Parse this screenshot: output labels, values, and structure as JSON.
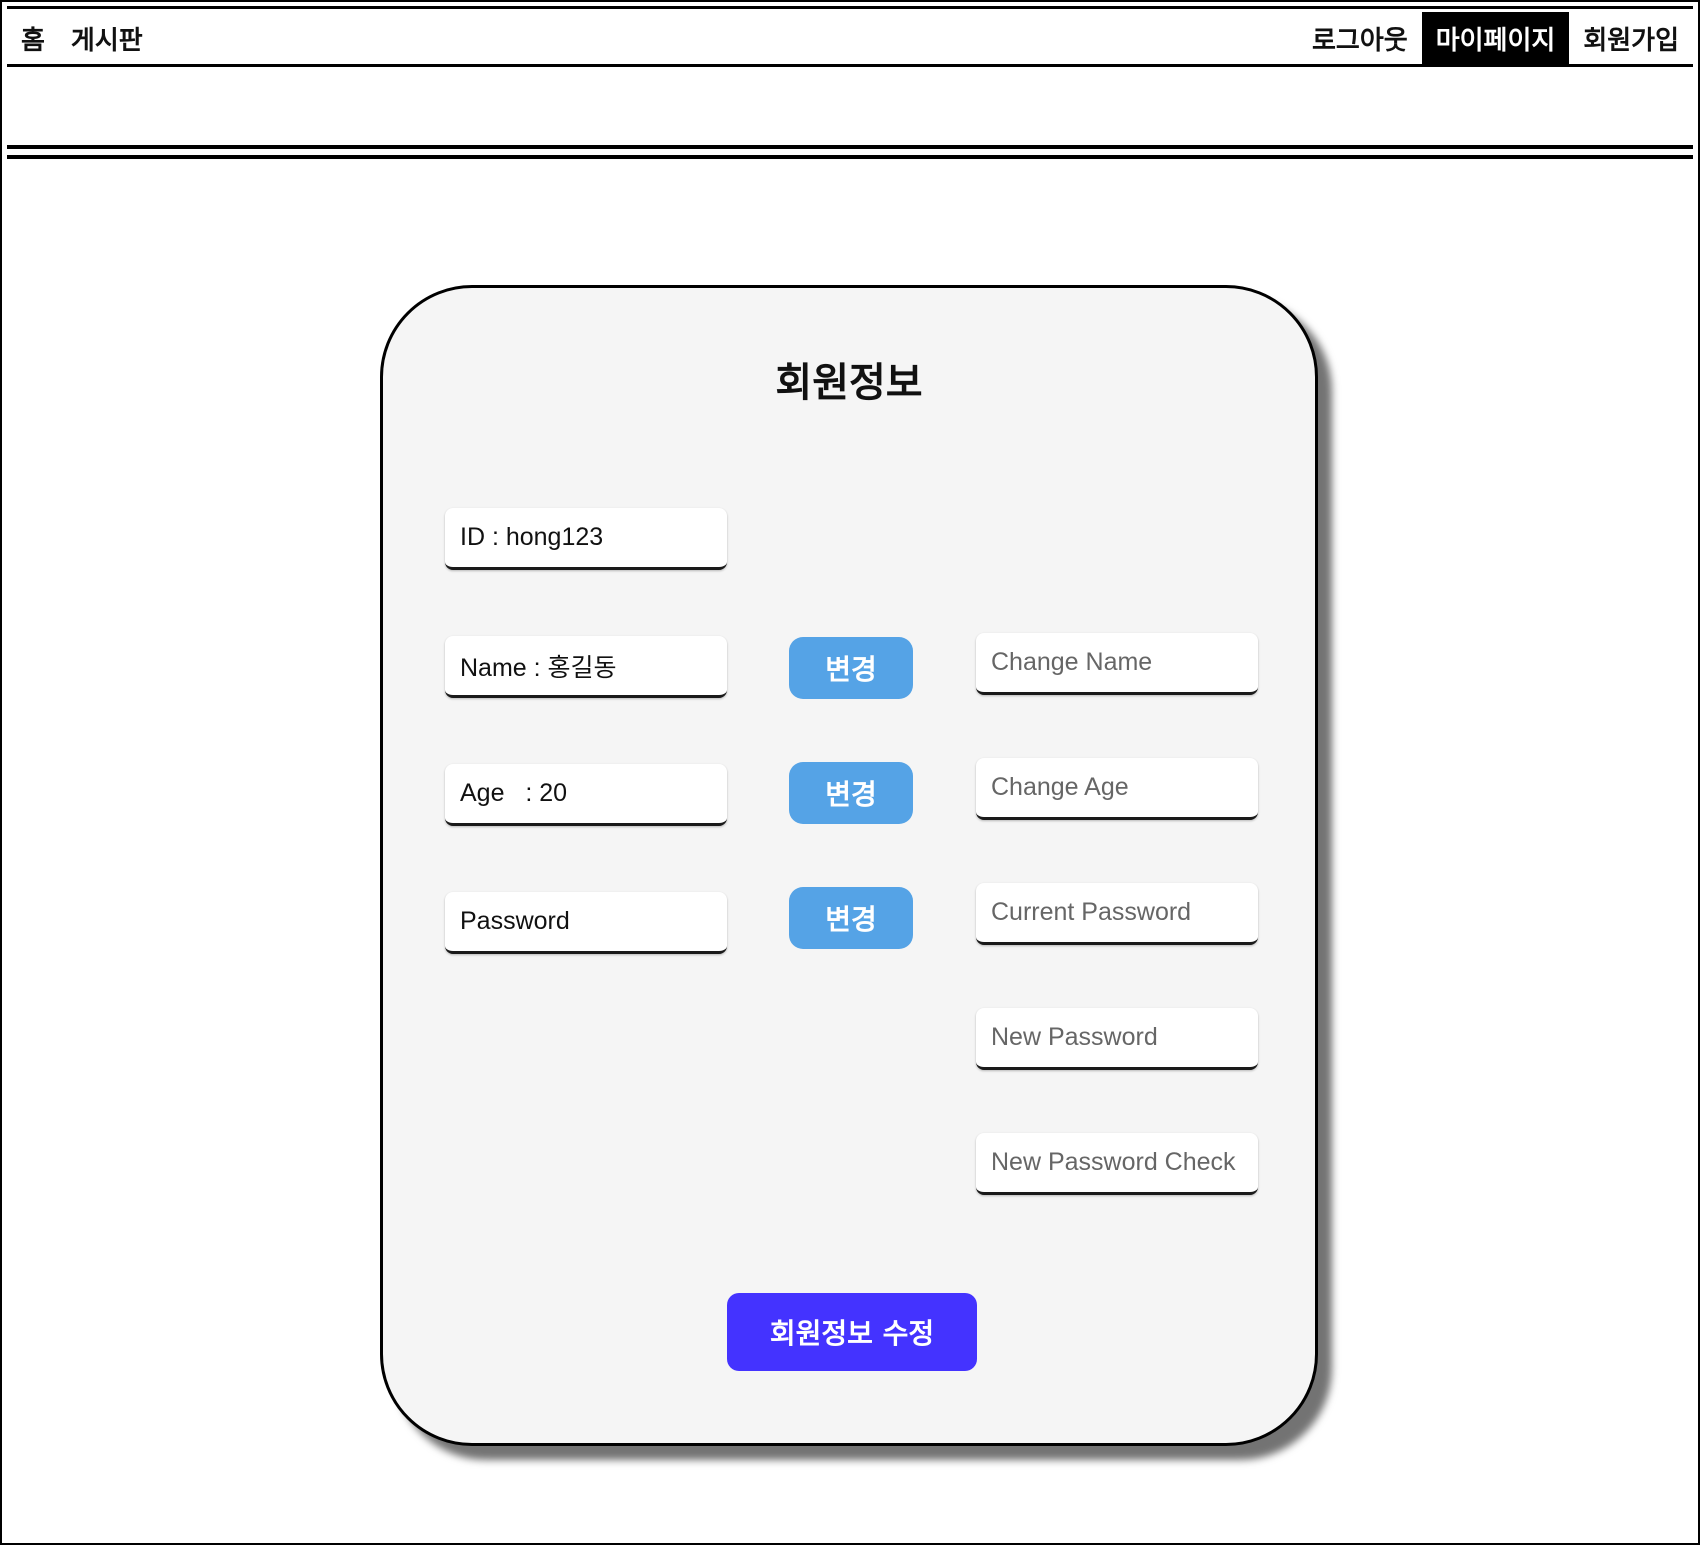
{
  "nav": {
    "left": [
      {
        "label": "홈"
      },
      {
        "label": "게시판"
      }
    ],
    "right": [
      {
        "label": "로그아웃"
      },
      {
        "label": "마이페이지"
      },
      {
        "label": "회원가입"
      }
    ]
  },
  "card": {
    "title": "회원정보",
    "id_display": "ID : hong123",
    "name_display": "Name : 홍길동",
    "age_display": "Age   : 20",
    "password_display": "Password",
    "change_label": "변경",
    "change_name_placeholder": "Change Name",
    "change_age_placeholder": "Change Age",
    "current_password_placeholder": "Current Password",
    "new_password_placeholder": "New Password",
    "new_password_check_placeholder": "New Password Check",
    "submit_label": "회원정보 수정"
  },
  "colors": {
    "change_button": "#55a3e6",
    "submit_button": "#4433ff",
    "active_nav": "#000000"
  }
}
